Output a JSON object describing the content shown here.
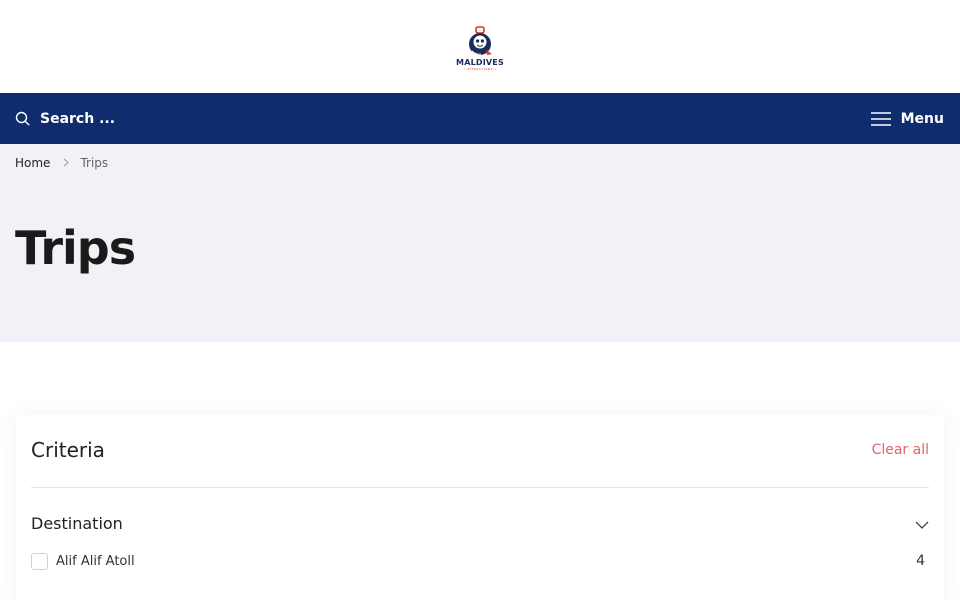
{
  "header": {
    "logo_text": "MALDIVES",
    "logo_subtext": "• ATTRACTIONS •"
  },
  "navbar": {
    "search_placeholder": "Search ...",
    "menu_label": "Menu"
  },
  "breadcrumb": {
    "home": "Home",
    "current": "Trips"
  },
  "page": {
    "title": "Trips"
  },
  "filters": {
    "title": "Criteria",
    "clear_label": "Clear all",
    "groups": [
      {
        "title": "Destination",
        "options": [
          {
            "label": "Alif Alif Atoll",
            "count": "4",
            "checked": false
          }
        ]
      }
    ]
  },
  "colors": {
    "navbar": "#0f2c6e",
    "hero_bg": "#f1f2f7",
    "clear_accent": "#e5616a",
    "logo_red": "#d9342b",
    "logo_navy": "#1b2c5c"
  }
}
